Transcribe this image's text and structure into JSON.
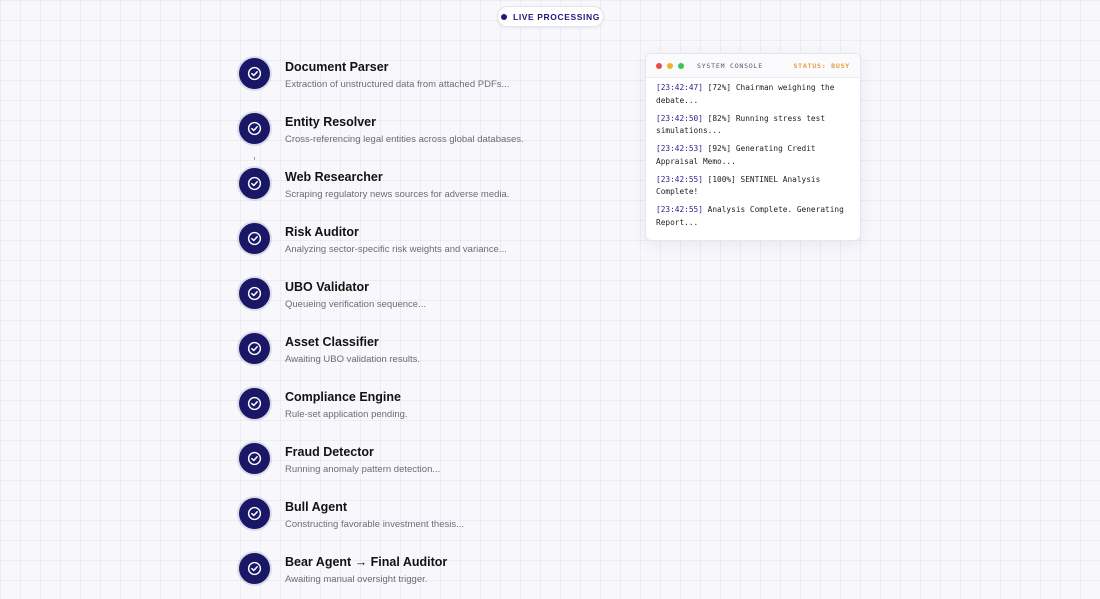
{
  "header": {
    "badge_label": "LIVE PROCESSING"
  },
  "colors": {
    "accent": "#1a1766",
    "status_busy": "#e89a3c",
    "light_red": "#e94a4a",
    "light_yellow": "#f2b32c",
    "light_green": "#36c55a"
  },
  "steps": [
    {
      "title": "Document Parser",
      "desc": "Extraction of unstructured data from attached PDFs...",
      "icon": "check-circle-icon"
    },
    {
      "title": "Entity Resolver",
      "desc": "Cross-referencing legal entities across global databases.",
      "icon": "check-circle-icon"
    },
    {
      "title": "Web Researcher",
      "desc": "Scraping regulatory news sources for adverse media.",
      "icon": "check-circle-icon"
    },
    {
      "title": "Risk Auditor",
      "desc": "Analyzing sector-specific risk weights and variance...",
      "icon": "check-circle-icon"
    },
    {
      "title": "UBO Validator",
      "desc": "Queueing verification sequence...",
      "icon": "check-circle-icon"
    },
    {
      "title": "Asset Classifier",
      "desc": "Awaiting UBO validation results.",
      "icon": "check-circle-icon"
    },
    {
      "title": "Compliance Engine",
      "desc": "Rule-set application pending.",
      "icon": "check-circle-icon"
    },
    {
      "title": "Fraud Detector",
      "desc": "Running anomaly pattern detection...",
      "icon": "check-circle-icon"
    },
    {
      "title": "Bull Agent",
      "desc": "Constructing favorable investment thesis...",
      "icon": "check-circle-icon"
    },
    {
      "title": "Bear Agent → Final Auditor",
      "desc": "Awaiting manual oversight trigger.",
      "icon": "check-circle-icon"
    }
  ],
  "console": {
    "title": "SYSTEM CONSOLE",
    "status": "STATUS: BUSY",
    "logs": [
      {
        "time": "[23:42:47]",
        "message": "[72%] Chairman weighing the debate..."
      },
      {
        "time": "[23:42:50]",
        "message": "[82%] Running stress test simulations..."
      },
      {
        "time": "[23:42:53]",
        "message": "[92%] Generating Credit Appraisal Memo..."
      },
      {
        "time": "[23:42:55]",
        "message": "[100%] SENTINEL Analysis Complete!"
      },
      {
        "time": "[23:42:55]",
        "message": "Analysis Complete. Generating Report..."
      }
    ]
  }
}
